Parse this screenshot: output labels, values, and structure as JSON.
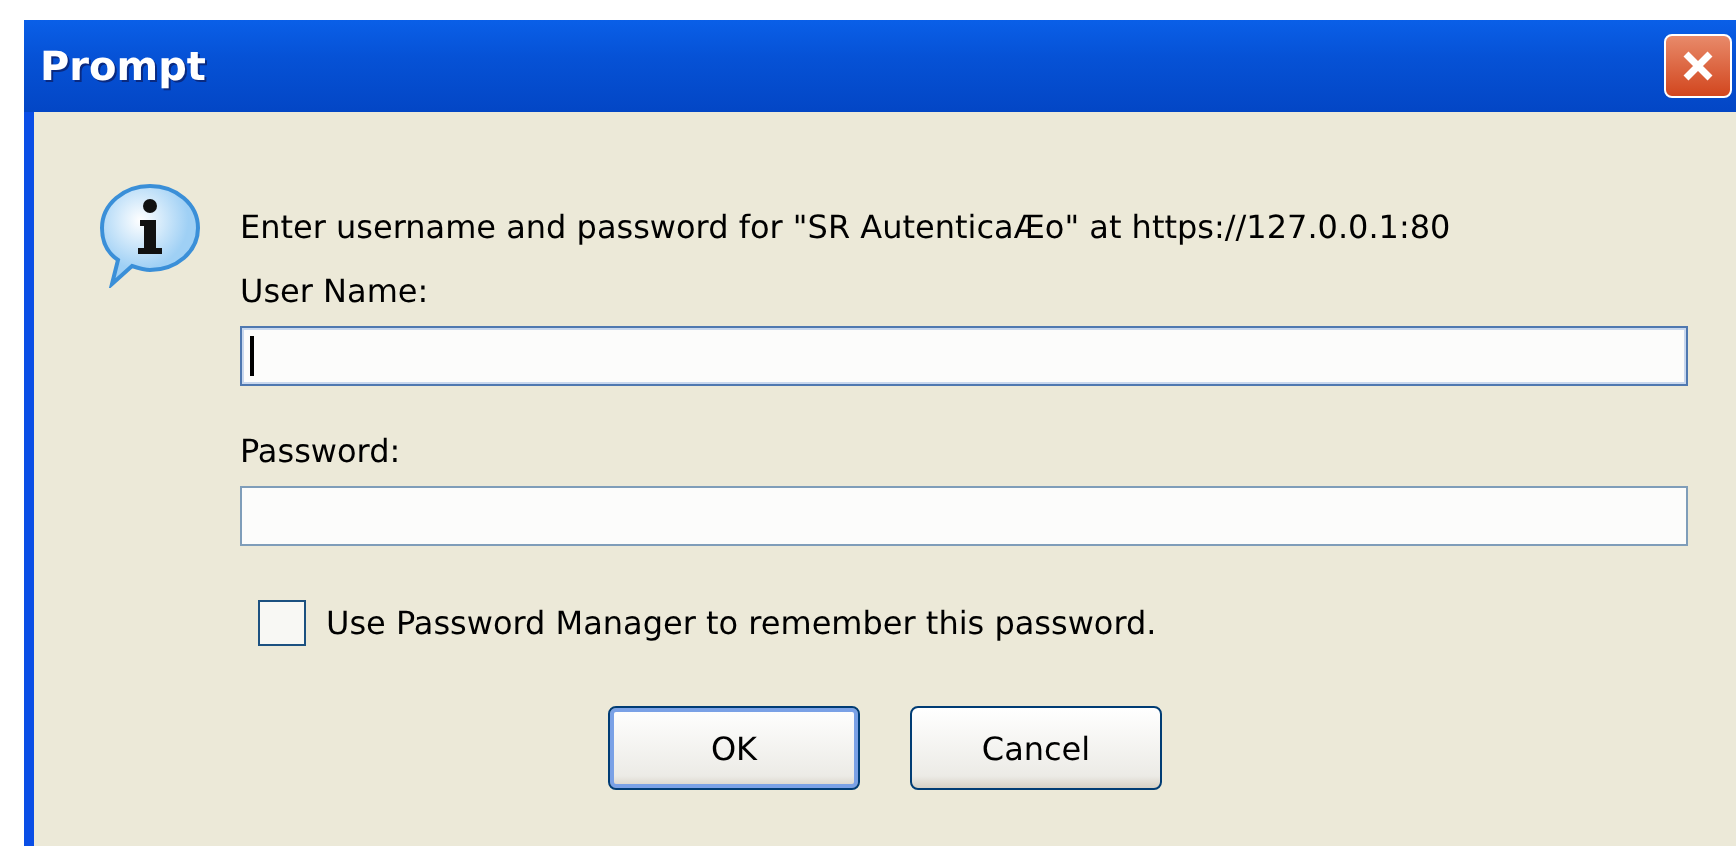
{
  "window": {
    "title": "Prompt"
  },
  "message": "Enter username and password for \"SR AutenticaÆo\" at https://127.0.0.1:80",
  "fields": [
    {
      "label": "User Name:",
      "focused": true
    },
    {
      "label": "Password:",
      "focused": false
    }
  ],
  "checkbox": {
    "label": "Use Password Manager to remember this password.",
    "checked": false
  },
  "buttons": [
    {
      "label": "OK",
      "default": true
    },
    {
      "label": "Cancel",
      "default": false
    }
  ]
}
